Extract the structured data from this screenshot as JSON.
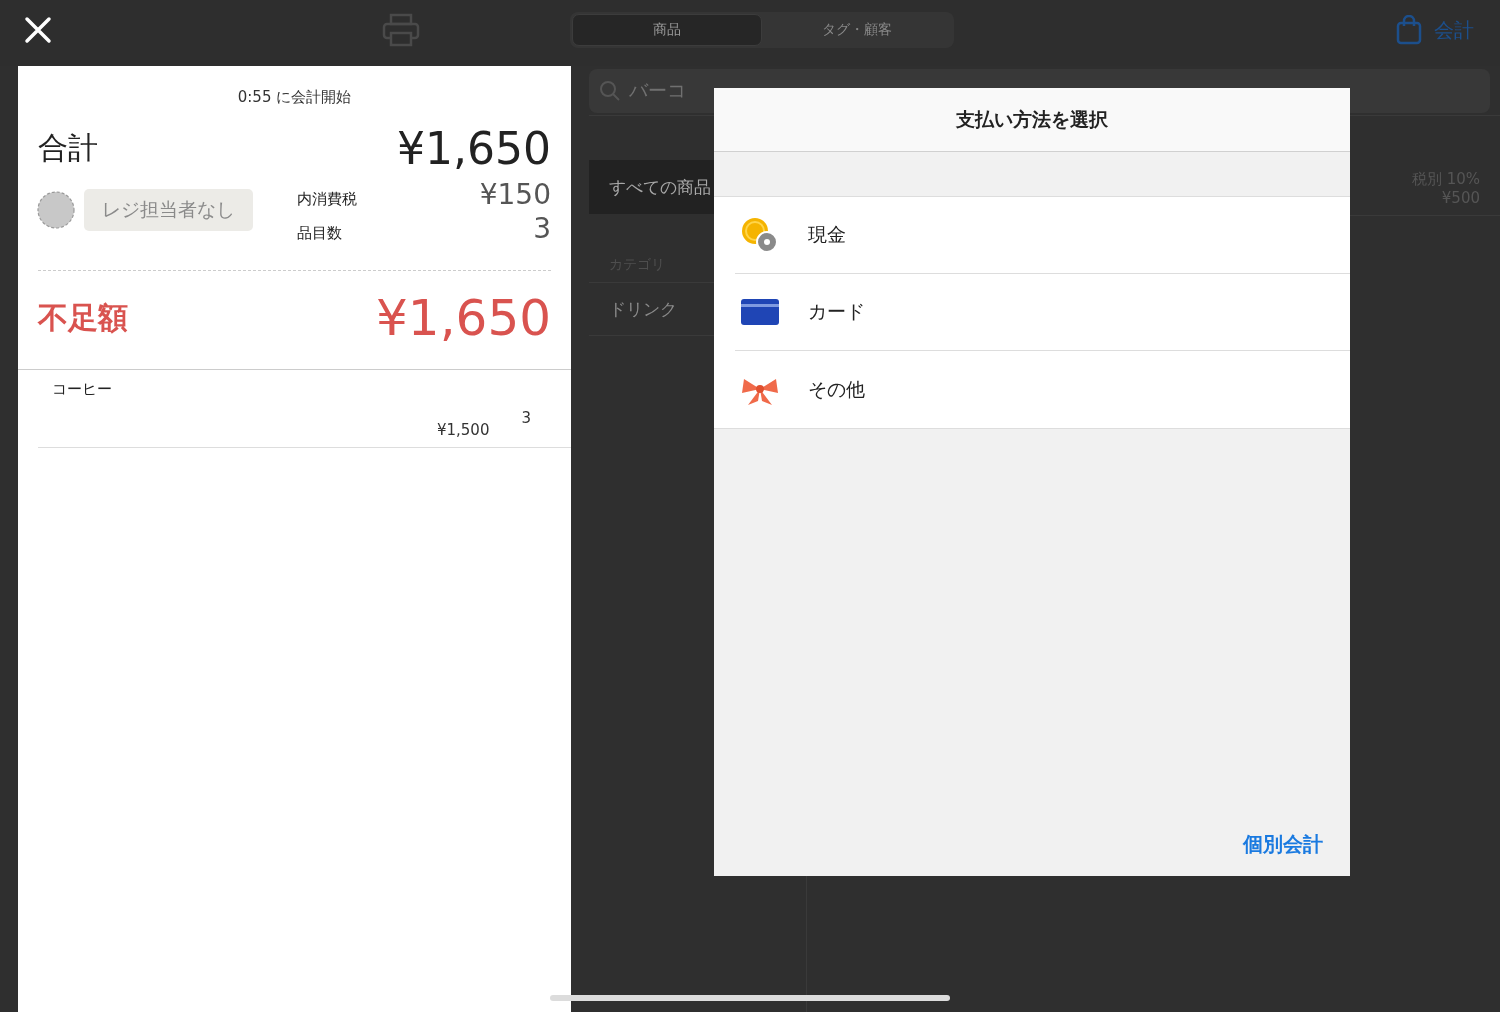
{
  "top_bar": {
    "tabs": [
      {
        "label": "商品",
        "selected": true
      },
      {
        "label": "タグ・顧客",
        "selected": false
      }
    ],
    "checkout": {
      "label": "会計"
    }
  },
  "cart": {
    "started": "0:55 に会計開始",
    "total_label": "合計",
    "total": "¥1,650",
    "staff": "レジ担当者なし",
    "tax_label": "内消費税",
    "tax": "¥150",
    "count_label": "品目数",
    "count": "3",
    "shortage_label": "不足額",
    "shortage": "¥1,650",
    "items": [
      {
        "name": "コーヒー",
        "price": "¥1,500",
        "quantity": "3"
      }
    ]
  },
  "search": {
    "placeholder": "バーコ"
  },
  "sidebar": {
    "items": [
      {
        "label": "すべての商品",
        "selected": true
      }
    ],
    "section_label": "カテゴリ",
    "categories": [
      {
        "label": "ドリンク",
        "selected": false
      }
    ]
  },
  "product_row": {
    "tax": "税別 10%",
    "price": "¥500"
  },
  "modal": {
    "title": "支払い方法を選択",
    "methods": [
      {
        "kind": "cash",
        "label": "現金"
      },
      {
        "kind": "card",
        "label": "カード"
      },
      {
        "kind": "other",
        "label": "その他"
      }
    ],
    "link": "個別会計"
  }
}
